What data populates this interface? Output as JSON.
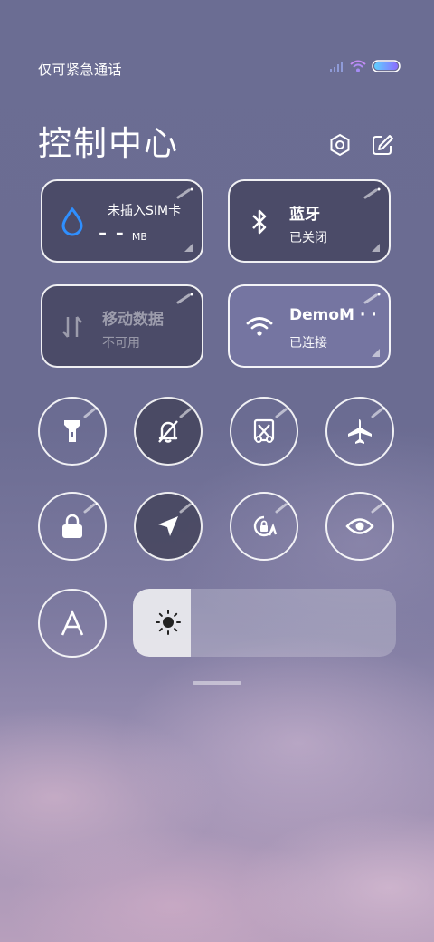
{
  "status_bar": {
    "carrier_text": "仅可紧急通话"
  },
  "header": {
    "title": "控制中心"
  },
  "tiles": {
    "sim": {
      "line1": "未插入SIM卡",
      "value": "- -",
      "unit": "MB"
    },
    "bluetooth": {
      "label": "蓝牙",
      "status": "已关闭"
    },
    "mobile_data": {
      "label": "移动数据",
      "status": "不可用"
    },
    "wifi": {
      "label": "DemoM · ·",
      "status": "已连接"
    }
  },
  "toggles": [
    {
      "name": "flashlight",
      "state": "off"
    },
    {
      "name": "silent",
      "state": "on"
    },
    {
      "name": "screenshot",
      "state": "off"
    },
    {
      "name": "airplane",
      "state": "off"
    },
    {
      "name": "lock-screen",
      "state": "off"
    },
    {
      "name": "location",
      "state": "on"
    },
    {
      "name": "auto-rotate",
      "state": "off"
    },
    {
      "name": "reading-mode",
      "state": "off"
    },
    {
      "name": "auto-brightness",
      "state": "off"
    }
  ],
  "brightness": {
    "level": 0.22
  },
  "colors": {
    "accent_blue": "#2f8fff",
    "tile_dark": "#3e3e58",
    "tile_active": "#7878a5"
  }
}
